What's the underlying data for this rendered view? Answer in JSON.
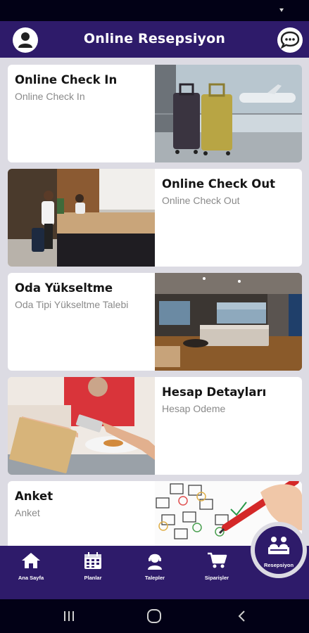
{
  "header": {
    "title": "Online Resepsiyon",
    "left_icon": "user-icon",
    "right_icon": "chat-bubble-icon"
  },
  "cards": [
    {
      "title": "Online Check In",
      "subtitle": "Online Check In",
      "image": "luggage-airport-photo"
    },
    {
      "title": "Online Check Out",
      "subtitle": "Online Check Out",
      "image": "hotel-reception-photo"
    },
    {
      "title": "Oda Yükseltme",
      "subtitle": "Oda Tipi Yükseltme Talebi",
      "image": "hotel-room-photo"
    },
    {
      "title": "Hesap Detayları",
      "subtitle": "Hesap Odeme",
      "image": "card-payment-photo"
    },
    {
      "title": "Anket",
      "subtitle": "Anket",
      "image": "survey-checklist-photo"
    }
  ],
  "bottom_nav": {
    "items": [
      {
        "label": "Ana Sayfa",
        "icon": "home-icon"
      },
      {
        "label": "Planlar",
        "icon": "calendar-icon"
      },
      {
        "label": "Talepler",
        "icon": "headset-icon"
      },
      {
        "label": "Siparişler",
        "icon": "cart-icon"
      }
    ],
    "active": {
      "label": "Resepsiyon",
      "icon": "reception-icon"
    }
  },
  "colors": {
    "primary": "#2e1b6a",
    "background": "#dcdbe3",
    "card": "#ffffff",
    "title_text": "#151515",
    "subtitle_text": "#8a8a8a"
  },
  "system_nav": [
    "recent-apps-icon",
    "home-circle-icon",
    "back-icon"
  ]
}
